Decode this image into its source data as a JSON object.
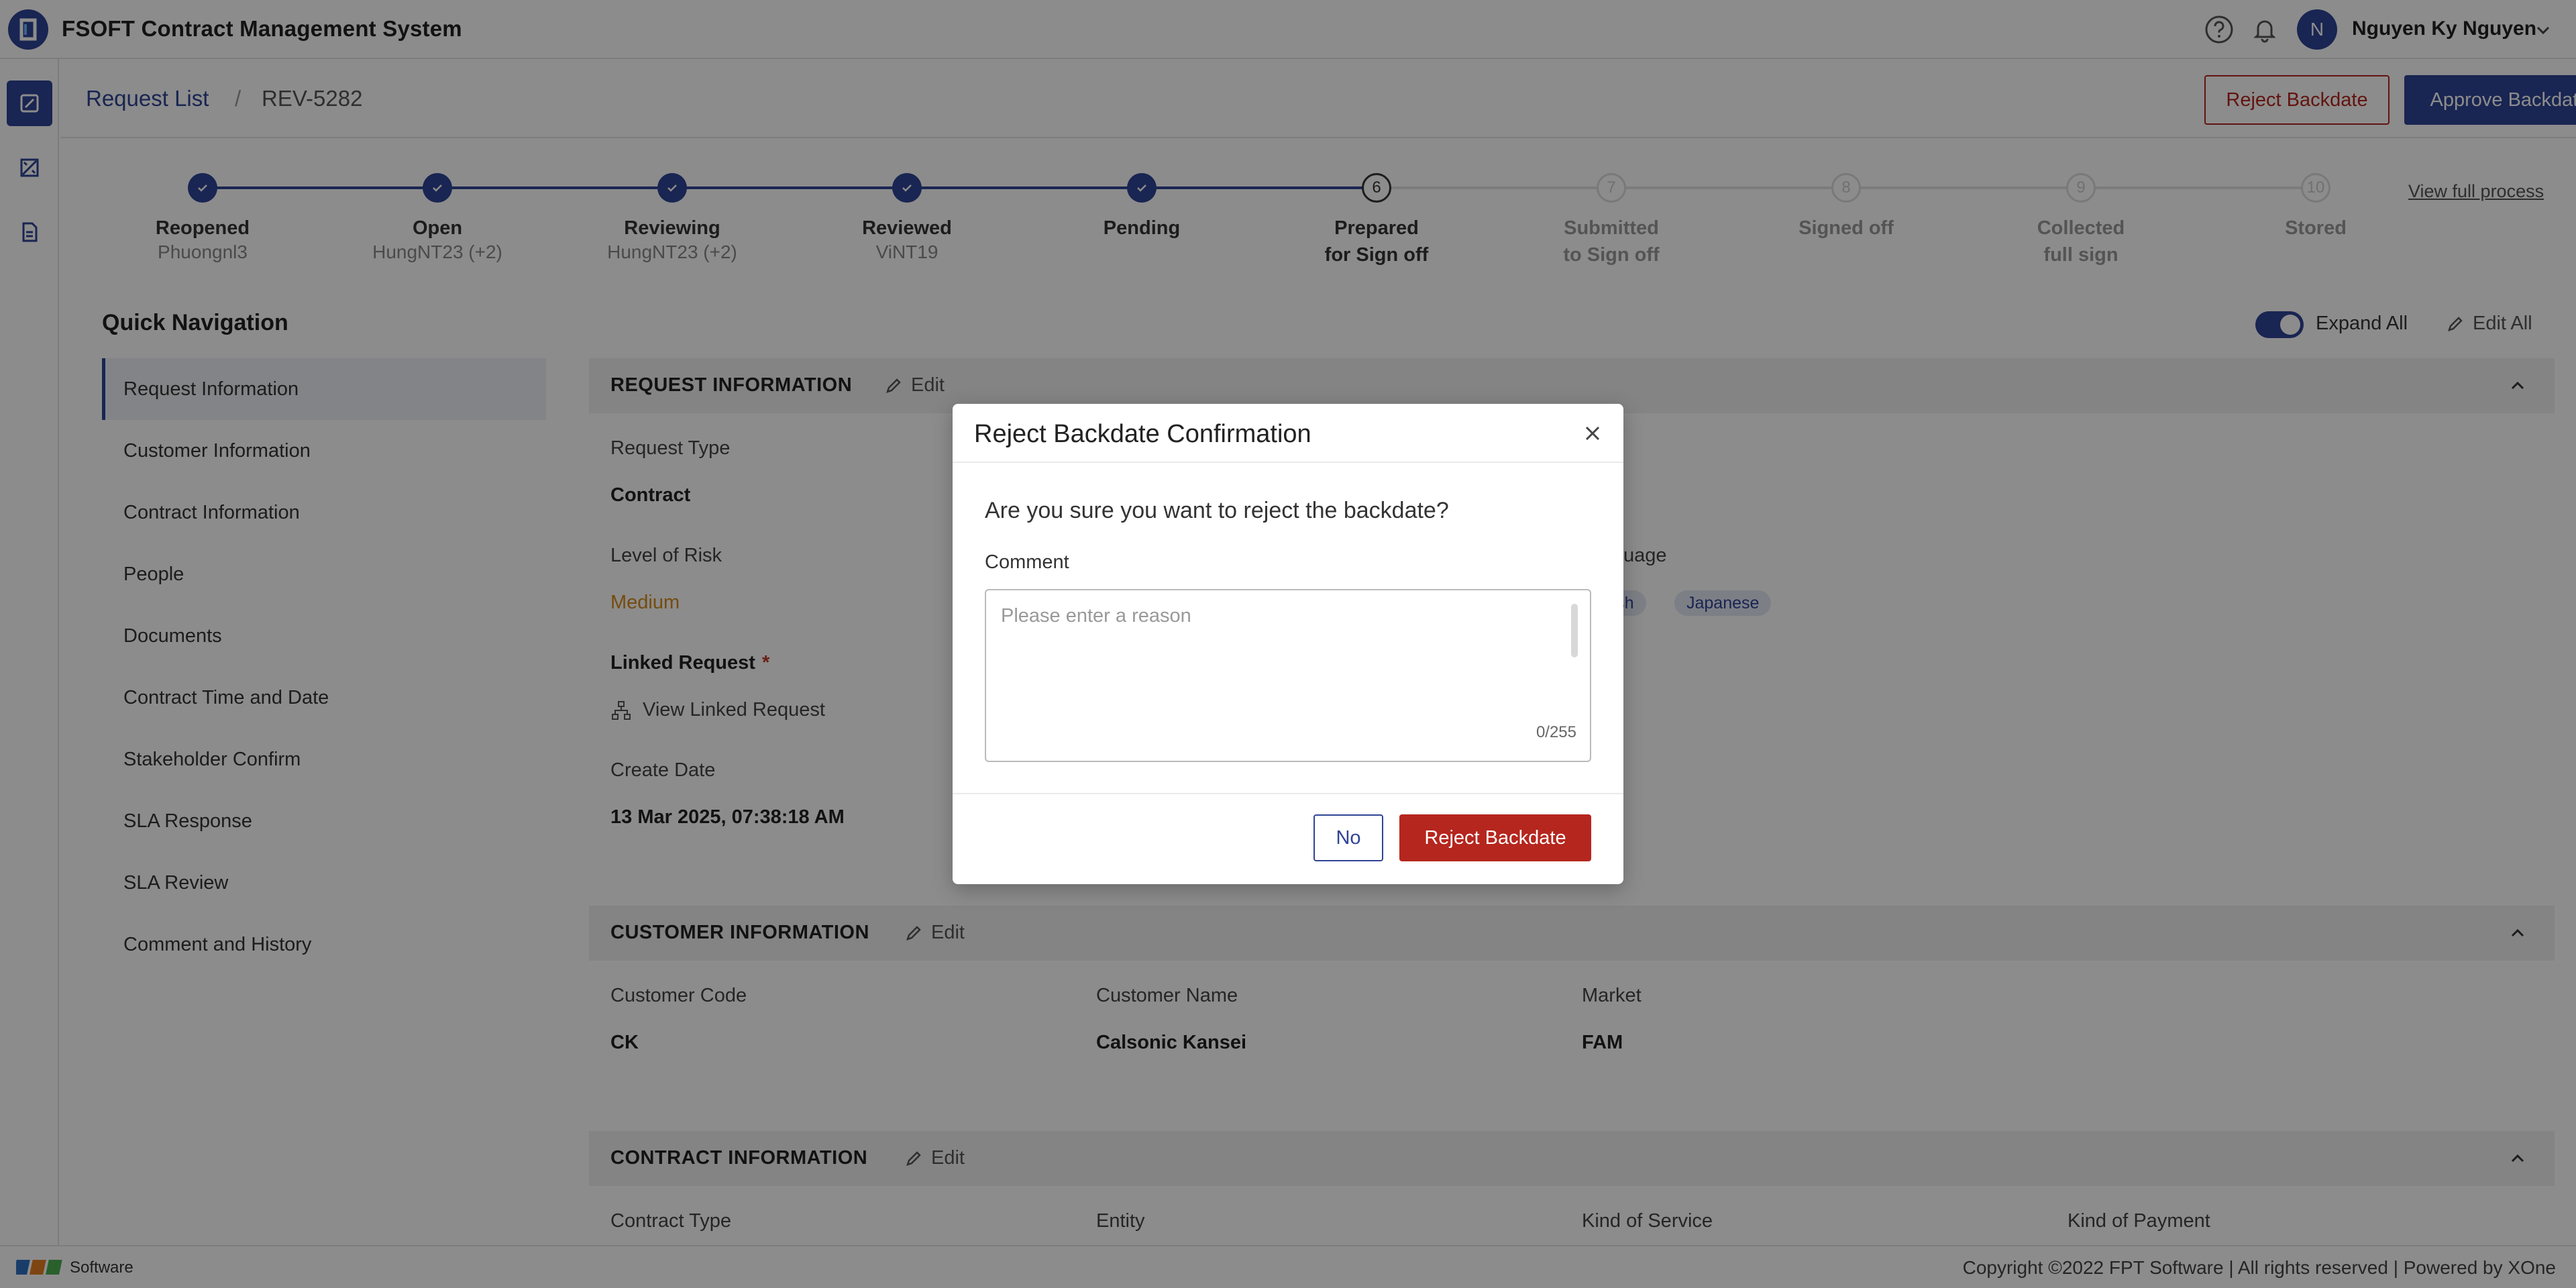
{
  "app": {
    "title": "FSOFT Contract Management System"
  },
  "header": {
    "user_initial": "N",
    "user_name": "Nguyen Ky Nguyen"
  },
  "breadcrumb": {
    "parent": "Request List",
    "separator": "/",
    "current": "REV-5282"
  },
  "actions": {
    "reject_label": "Reject Backdate",
    "approve_label": "Approve Backdate"
  },
  "stepper": {
    "view_full_process": "View full process",
    "steps": [
      {
        "title": "Reopened",
        "title2": "",
        "sub": "Phuongnl3",
        "state": "done",
        "num": ""
      },
      {
        "title": "Open",
        "title2": "",
        "sub": "HungNT23 (+2)",
        "state": "done",
        "num": ""
      },
      {
        "title": "Reviewing",
        "title2": "",
        "sub": "HungNT23 (+2)",
        "state": "done",
        "num": ""
      },
      {
        "title": "Reviewed",
        "title2": "",
        "sub": "ViNT19",
        "state": "done",
        "num": ""
      },
      {
        "title": "Pending",
        "title2": "",
        "sub": "",
        "state": "done",
        "num": ""
      },
      {
        "title": "Prepared",
        "title2": "for Sign off",
        "sub": "",
        "state": "current",
        "num": "6"
      },
      {
        "title": "Submitted",
        "title2": "to Sign off",
        "sub": "",
        "state": "future",
        "num": "7"
      },
      {
        "title": "Signed off",
        "title2": "",
        "sub": "",
        "state": "future",
        "num": "8"
      },
      {
        "title": "Collected",
        "title2": "full sign",
        "sub": "",
        "state": "future",
        "num": "9"
      },
      {
        "title": "Stored",
        "title2": "",
        "sub": "",
        "state": "future",
        "num": "10"
      }
    ]
  },
  "quick_nav": {
    "title": "Quick Navigation",
    "expand_all": "Expand All",
    "edit_all": "Edit All",
    "items": [
      "Request Information",
      "Customer Information",
      "Contract Information",
      "People",
      "Documents",
      "Contract Time and Date",
      "Stakeholder Confirm",
      "SLA Response",
      "SLA Review",
      "Comment and History"
    ]
  },
  "sections": {
    "edit_label": "Edit",
    "request": {
      "title": "REQUEST INFORMATION",
      "request_type_label": "Request Type",
      "request_type_value": "Contract",
      "risk_label": "Level of Risk",
      "risk_value": "Medium",
      "language_label_fragment": "uage",
      "language_tags": [
        "lish",
        "Japanese"
      ],
      "linked_label": "Linked Request",
      "linked_star": "*",
      "view_linked": "View Linked Request",
      "create_date_label": "Create Date",
      "create_date_value": "13 Mar 2025, 07:38:18 AM"
    },
    "customer": {
      "title": "CUSTOMER INFORMATION",
      "code_label": "Customer Code",
      "code_value": "CK",
      "name_label": "Customer Name",
      "name_value": "Calsonic Kansei",
      "market_label": "Market",
      "market_value": "FAM"
    },
    "contract": {
      "title": "CONTRACT INFORMATION",
      "type_label": "Contract Type",
      "entity_label": "Entity",
      "service_label": "Kind of Service",
      "payment_label": "Kind of Payment"
    }
  },
  "footer": {
    "brand": "Software",
    "copyright": "Copyright ©2022 FPT Software | All rights reserved | Powered by XOne"
  },
  "modal": {
    "title": "Reject Backdate Confirmation",
    "question": "Are you sure you want to reject the backdate?",
    "comment_label": "Comment",
    "comment_placeholder": "Please enter a reason",
    "comment_value": "",
    "char_count": "0/255",
    "no_label": "No",
    "confirm_label": "Reject Backdate"
  },
  "colors": {
    "primary": "#2f4496",
    "danger": "#b5261e",
    "risk_medium": "#d68a1a"
  }
}
